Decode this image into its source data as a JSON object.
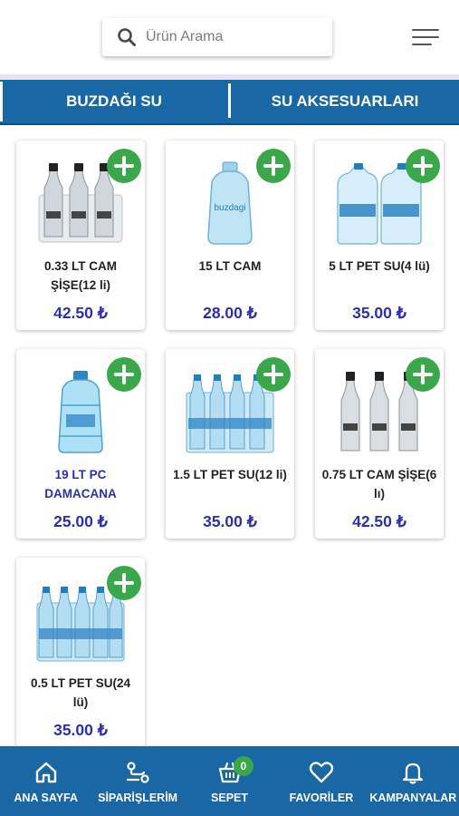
{
  "search": {
    "placeholder": "Ürün Arama"
  },
  "tabs": [
    {
      "label": "BUZDAĞI SU"
    },
    {
      "label": "SU AKSESUARLARI"
    }
  ],
  "products": [
    {
      "name": "0.33 LT CAM ŞİŞE(12 li)",
      "price": "42.50 ₺",
      "name_color": "dark",
      "icon": "glass-bottle-pack-icon"
    },
    {
      "name": "15 LT CAM",
      "price": "28.00 ₺",
      "name_color": "dark",
      "icon": "glass-demijohn-icon"
    },
    {
      "name": "5 LT PET SU(4 lü)",
      "price": "35.00 ₺",
      "name_color": "dark",
      "icon": "pet-jug-pack-icon"
    },
    {
      "name": "19 LT PC DAMACANA",
      "price": "25.00 ₺",
      "name_color": "blue",
      "icon": "pc-demijohn-icon"
    },
    {
      "name": "1.5 LT PET SU(12 li)",
      "price": "35.00 ₺",
      "name_color": "dark",
      "icon": "pet-bottle-pack-icon"
    },
    {
      "name": "0.75 LT CAM ŞİŞE(6 lı)",
      "price": "42.50 ₺",
      "name_color": "dark",
      "icon": "glass-bottle-pack-icon"
    },
    {
      "name": "0.5 LT PET SU(24 lü)",
      "price": "35.00 ₺",
      "name_color": "dark",
      "icon": "pet-bottle-pack-icon"
    }
  ],
  "nav": [
    {
      "label": "ANA SAYFA",
      "icon": "home-icon"
    },
    {
      "label": "SİPARİŞLERİM",
      "icon": "route-icon"
    },
    {
      "label": "SEPET",
      "icon": "basket-icon",
      "badge": "0"
    },
    {
      "label": "FAVORİLER",
      "icon": "heart-icon"
    },
    {
      "label": "KAMPANYALAR",
      "icon": "bell-icon"
    }
  ],
  "colors": {
    "primary": "#1a67a6",
    "accent_green": "#3aa84a",
    "price_blue": "#2c2fb0"
  }
}
